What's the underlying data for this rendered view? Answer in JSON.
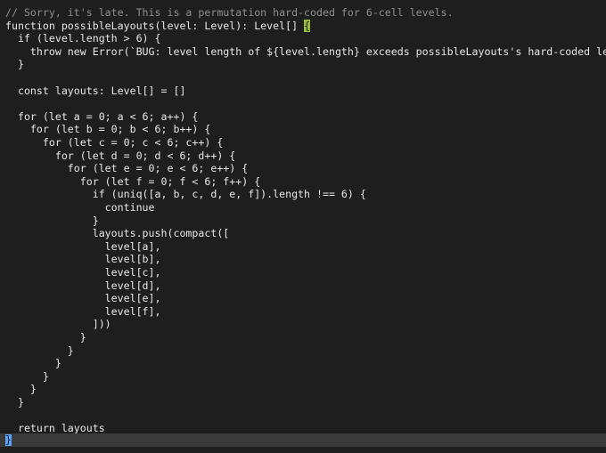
{
  "code_lines": [
    "// Sorry, it's late. This is a permutation hard-coded for 6-cell levels.",
    "function possibleLayouts(level: Level): Level[] ",
    "  if (level.length > 6) {",
    "    throw new Error(`BUG: level length of ${level.length} exceeds possibleLayouts's hard-coded level size`)",
    "  }",
    "",
    "  const layouts: Level[] = []",
    "",
    "  for (let a = 0; a < 6; a++) {",
    "    for (let b = 0; b < 6; b++) {",
    "      for (let c = 0; c < 6; c++) {",
    "        for (let d = 0; d < 6; d++) {",
    "          for (let e = 0; e < 6; e++) {",
    "            for (let f = 0; f < 6; f++) {",
    "              if (uniq([a, b, c, d, e, f]).length !== 6) {",
    "                continue",
    "              }",
    "              layouts.push(compact([",
    "                level[a],",
    "                level[b],",
    "                level[c],",
    "                level[d],",
    "                level[e],",
    "                level[f],",
    "              ]))",
    "            }",
    "          }",
    "        }",
    "      }",
    "    }",
    "  }",
    "",
    "  return layouts",
    "}"
  ],
  "highlighted_brace": "{",
  "colors": {
    "background": "#1e1e1e",
    "text": "#e8e8e8",
    "comment": "#8f8f8f",
    "active_line": "#3a3a3a",
    "cursor": "#5aa2ff",
    "brace_highlight": "#9bbb35"
  }
}
